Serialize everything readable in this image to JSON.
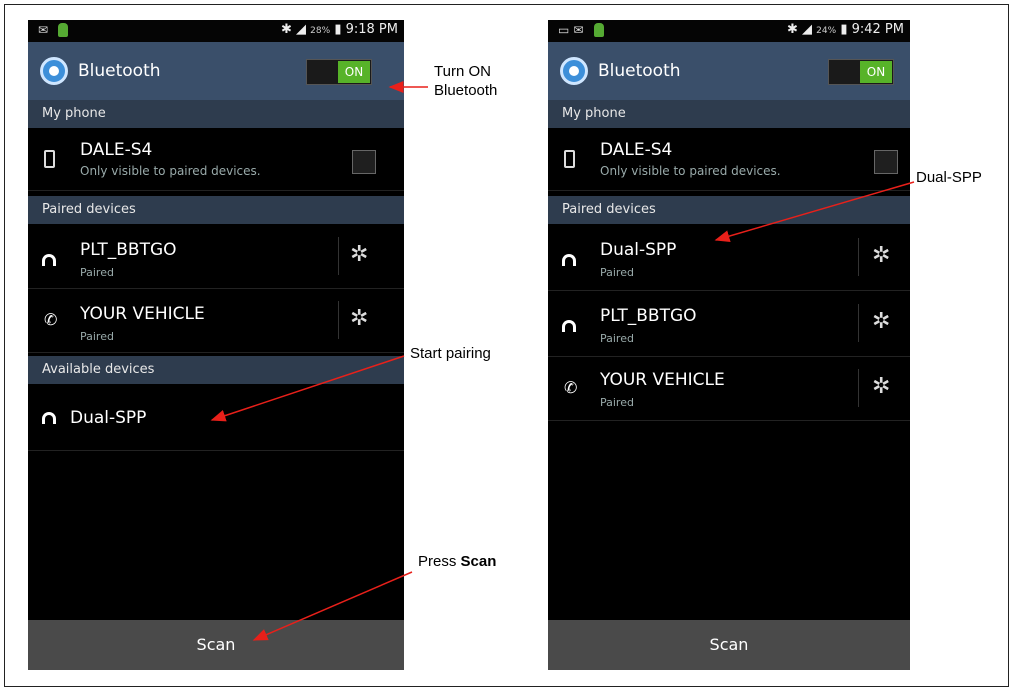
{
  "left_phone": {
    "status": {
      "percent": "28%",
      "time": "9:18 PM"
    },
    "title": "Bluetooth",
    "toggle_label": "ON",
    "sections": {
      "my_phone": "My phone",
      "paired": "Paired devices",
      "available": "Available devices"
    },
    "my_device": {
      "name": "DALE-S4",
      "sub": "Only visible to paired devices."
    },
    "paired": [
      {
        "name": "PLT_BBTGO",
        "sub": "Paired",
        "icon": "headset-icon"
      },
      {
        "name": "YOUR VEHICLE",
        "sub": "Paired",
        "icon": "phone-call-icon"
      }
    ],
    "available": [
      {
        "name": "Dual-SPP",
        "icon": "headset-icon"
      }
    ],
    "scan_label": "Scan"
  },
  "right_phone": {
    "status": {
      "percent": "24%",
      "time": "9:42 PM"
    },
    "title": "Bluetooth",
    "toggle_label": "ON",
    "sections": {
      "my_phone": "My phone",
      "paired": "Paired devices"
    },
    "my_device": {
      "name": "DALE-S4",
      "sub": "Only visible to paired devices."
    },
    "paired": [
      {
        "name": "Dual-SPP",
        "sub": "Paired",
        "icon": "headset-icon"
      },
      {
        "name": "PLT_BBTGO",
        "sub": "Paired",
        "icon": "headset-icon"
      },
      {
        "name": "YOUR VEHICLE",
        "sub": "Paired",
        "icon": "phone-call-icon"
      }
    ],
    "scan_label": "Scan"
  },
  "annotations": {
    "turn_on": [
      "Turn ON",
      "Bluetooth"
    ],
    "start_pairing": "Start pairing",
    "press": "Press",
    "scan": "Scan",
    "dual_spp": "Dual-SPP"
  },
  "colors": {
    "titlebar": "#3a4f6a",
    "section": "#2e3c4e",
    "toggle_on": "#57b329",
    "arrow": "#e8201a"
  }
}
